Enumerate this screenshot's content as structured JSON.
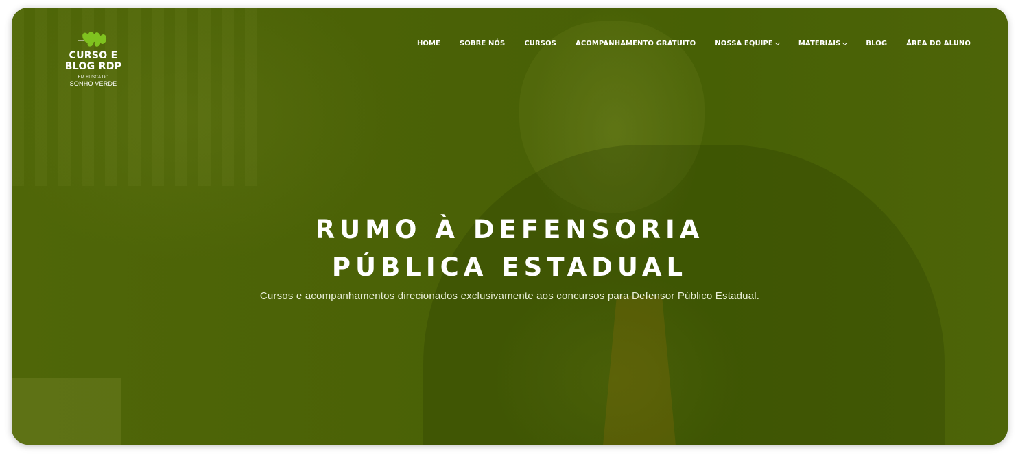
{
  "logo": {
    "line1": "CURSO E",
    "line2": "BLOG RDP",
    "tagline_small": "EM BUSCA DO",
    "tagline": "SONHO VERDE",
    "icon": "leaf-icon"
  },
  "nav": {
    "items": [
      {
        "label": "HOME",
        "dropdown": false
      },
      {
        "label": "SOBRE NÓS",
        "dropdown": false
      },
      {
        "label": "CURSOS",
        "dropdown": false
      },
      {
        "label": "ACOMPANHAMENTO GRATUITO",
        "dropdown": false
      },
      {
        "label": "NOSSA EQUIPE",
        "dropdown": true
      },
      {
        "label": "MATERIAIS",
        "dropdown": true
      },
      {
        "label": "BLOG",
        "dropdown": false
      },
      {
        "label": "ÁREA DO ALUNO",
        "dropdown": false
      }
    ]
  },
  "hero": {
    "title_line1": "RUMO À DEFENSORIA",
    "title_line2": "PÚBLICA ESTADUAL",
    "subtitle": "Cursos e acompanhamentos direcionados exclusivamente aos concursos para Defensor Público Estadual."
  },
  "colors": {
    "overlay": "#4b6207",
    "leaf": "#7fc21f",
    "text": "#ffffff"
  }
}
